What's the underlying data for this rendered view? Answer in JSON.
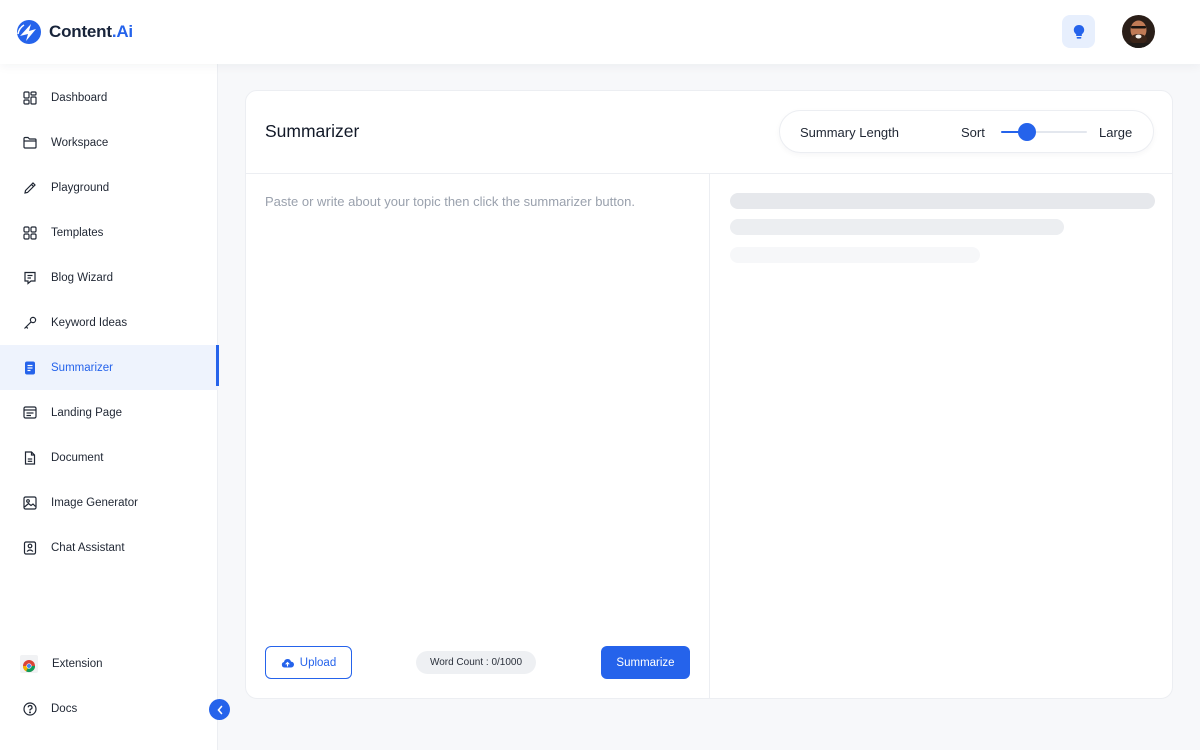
{
  "app": {
    "brand_primary": "Content",
    "brand_accent": ".Ai",
    "accent_color": "#2563eb",
    "help_icon": "lightbulb-icon"
  },
  "sidebar": {
    "items": [
      {
        "label": "Dashboard",
        "icon": "dashboard-icon",
        "active": false
      },
      {
        "label": "Workspace",
        "icon": "folder-icon",
        "active": false
      },
      {
        "label": "Playground",
        "icon": "pencil-icon",
        "active": false
      },
      {
        "label": "Templates",
        "icon": "grid-icon",
        "active": false
      },
      {
        "label": "Blog Wizard",
        "icon": "blog-icon",
        "active": false
      },
      {
        "label": "Keyword Ideas",
        "icon": "key-icon",
        "active": false
      },
      {
        "label": "Summarizer",
        "icon": "document-icon",
        "active": true
      },
      {
        "label": "Landing Page",
        "icon": "landing-page-icon",
        "active": false
      },
      {
        "label": "Document",
        "icon": "file-icon",
        "active": false
      },
      {
        "label": "Image Generator",
        "icon": "image-icon",
        "active": false
      },
      {
        "label": "Chat Assistant",
        "icon": "chat-icon",
        "active": false
      }
    ],
    "bottom_items": [
      {
        "label": "Extension",
        "icon": "chrome-icon"
      },
      {
        "label": "Docs",
        "icon": "help-circle-icon"
      }
    ],
    "collapse_icon": "chevron-left-icon"
  },
  "main": {
    "title": "Summarizer",
    "summary_length": {
      "label": "Summary Length",
      "min_label": "Sort",
      "max_label": "Large",
      "value": 0.25
    },
    "editor": {
      "placeholder": "Paste or write about your topic then click the summarizer button.",
      "value": ""
    },
    "upload_label": "Upload",
    "word_count": "Word Count : 0/1000",
    "summarize_label": "Summarize"
  }
}
